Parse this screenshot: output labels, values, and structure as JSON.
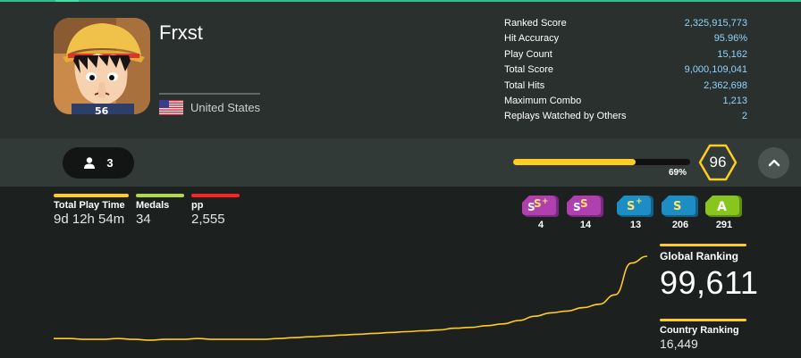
{
  "profile": {
    "username": "Frxst",
    "country": "United States",
    "avatar_icon": "anime-character-avatar"
  },
  "stats": [
    {
      "label": "Ranked Score",
      "value": "2,325,915,773"
    },
    {
      "label": "Hit Accuracy",
      "value": "95.96%"
    },
    {
      "label": "Play Count",
      "value": "15,162"
    },
    {
      "label": "Total Score",
      "value": "9,000,109,041"
    },
    {
      "label": "Total Hits",
      "value": "2,362,698"
    },
    {
      "label": "Maximum Combo",
      "value": "1,213"
    },
    {
      "label": "Replays Watched by Others",
      "value": "2"
    }
  ],
  "friends": {
    "count": "3",
    "icon": "user-icon"
  },
  "level": {
    "progress_label": "69%",
    "progress_fraction": 0.69,
    "level": "96"
  },
  "info": [
    {
      "label": "Total Play Time",
      "value": "9d 12h 54m",
      "color": "#ffcc22"
    },
    {
      "label": "Medals",
      "value": "34",
      "color": "#b3d944"
    },
    {
      "label": "pp",
      "value": "2,555",
      "color": "#ff2222"
    }
  ],
  "grades": [
    {
      "grade": "SS+",
      "count": "4",
      "color": "#b03fb0"
    },
    {
      "grade": "SS",
      "count": "14",
      "color": "#b03fb0"
    },
    {
      "grade": "S+",
      "count": "13",
      "color": "#1d8ec3"
    },
    {
      "grade": "S",
      "count": "206",
      "color": "#1d8ec3"
    },
    {
      "grade": "A",
      "count": "291",
      "color": "#88c61e"
    }
  ],
  "ranking": {
    "global_label": "Global Ranking",
    "global_value": "99,611",
    "country_label": "Country Ranking",
    "country_value": "16,449"
  },
  "colors": {
    "accent": "#ffcc22",
    "stat_value": "#8fd3ff",
    "top_accent": "#2fbf8f"
  },
  "chart_data": {
    "type": "line",
    "title": "",
    "xlabel": "",
    "ylabel": "",
    "note_y": "relative rank-history trend (higher = better rank), unlabeled axes",
    "values": [
      0.04,
      0.04,
      0.03,
      0.03,
      0.04,
      0.03,
      0.02,
      0.03,
      0.03,
      0.04,
      0.03,
      0.03,
      0.03,
      0.03,
      0.04,
      0.05,
      0.06,
      0.07,
      0.08,
      0.09,
      0.1,
      0.11,
      0.12,
      0.13,
      0.14,
      0.16,
      0.17,
      0.19,
      0.21,
      0.25,
      0.3,
      0.34,
      0.36,
      0.4,
      0.44,
      0.55,
      0.92,
      1.0
    ]
  }
}
